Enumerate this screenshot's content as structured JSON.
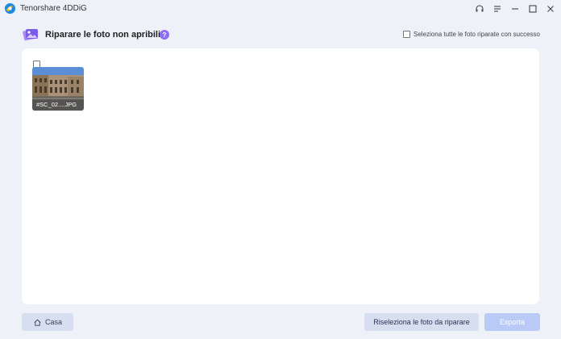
{
  "app": {
    "title": "Tenorshare 4DDiG"
  },
  "header": {
    "title": "Riparare le foto non apribili",
    "help_symbol": "?",
    "select_all_label": "Seleziona tutte le foto riparate con successo"
  },
  "photos": [
    {
      "name": "#SC_02....JPG",
      "checked": false
    }
  ],
  "footer": {
    "home_label": "Casa",
    "reselect_label": "Riseleziona le foto da riparare",
    "export_label": "Esporta"
  },
  "colors": {
    "background": "#eef1f8",
    "panel": "#ffffff",
    "accent": "#8d6df0",
    "secondary_button": "#d6def0",
    "primary_button_disabled": "#b9caf6"
  }
}
